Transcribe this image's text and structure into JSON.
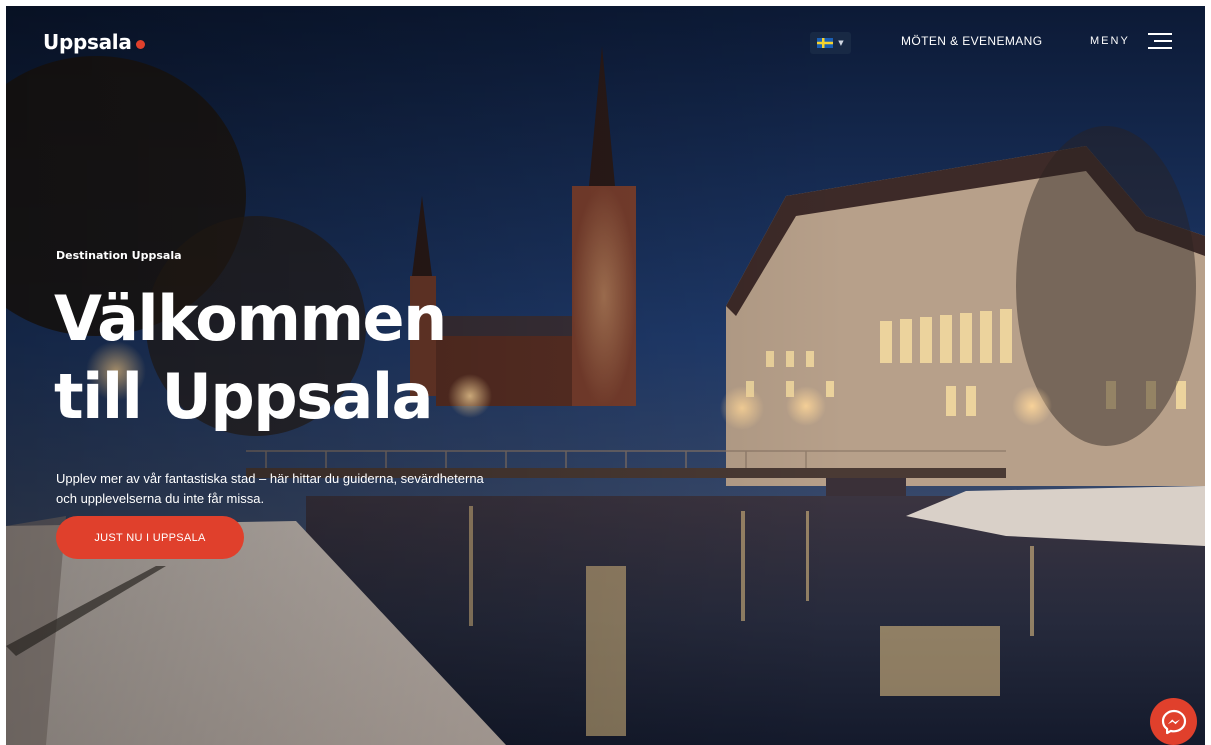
{
  "header": {
    "logo_text": "Uppsala",
    "logo_dot_color": "#e0402c",
    "language_selector": {
      "icon": "swedish-flag-icon",
      "caret_icon": "chevron-down-icon"
    },
    "meetings_link": "MÖTEN & EVENEMANG",
    "menu_label": "MENY",
    "menu_icon": "hamburger-icon"
  },
  "hero": {
    "eyebrow": "Destination Uppsala",
    "headline_line1": "Välkommen",
    "headline_line2": "till Uppsala",
    "subtext": "Upplev mer av vår fantastiska stad – här hittar du guiderna, sevärdheterna och upplevelserna du inte får missa.",
    "cta_label": "JUST NU I UPPSALA",
    "background": "uppsala-cathedral-river-night-photo"
  },
  "chat": {
    "icon": "messenger-icon",
    "color": "#e0402c"
  }
}
